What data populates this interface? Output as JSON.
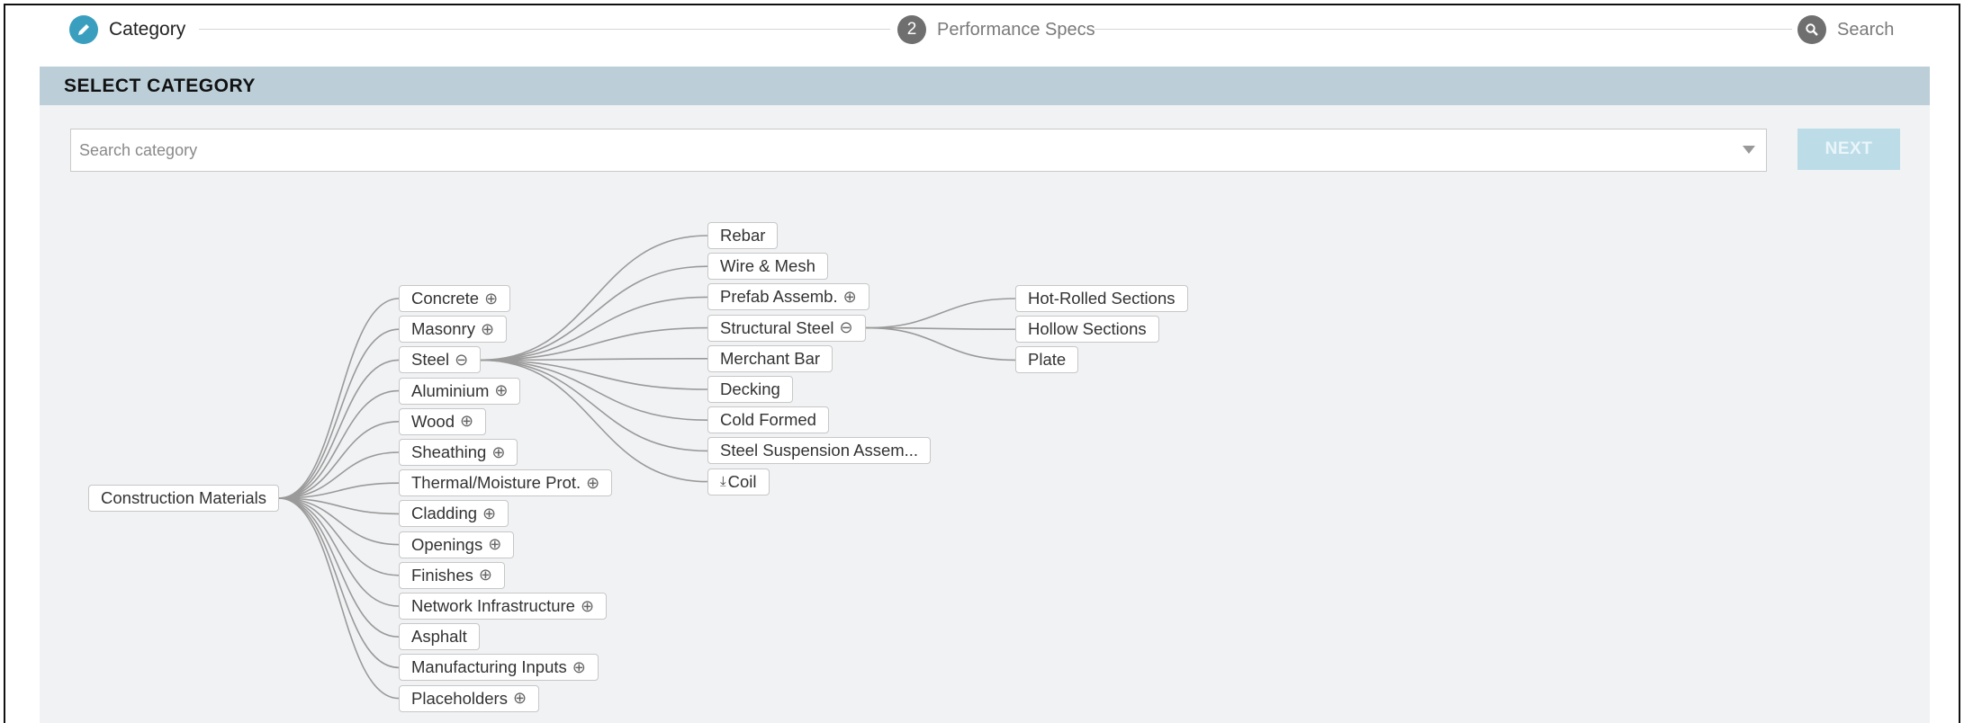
{
  "stepper": {
    "steps": [
      {
        "label": "Category",
        "icon": "pencil-icon"
      },
      {
        "label": "Performance Specs",
        "number": "2"
      },
      {
        "label": "Search",
        "icon": "search-icon"
      }
    ]
  },
  "panel": {
    "title": "SELECT CATEGORY",
    "search_placeholder": "Search category",
    "next_label": "NEXT"
  },
  "colors": {
    "accent": "#3a9fbf",
    "header_bg": "#bccfd9",
    "panel_bg": "#f1f2f4",
    "next_disabled": "#bcdde8"
  },
  "tree": {
    "root": {
      "label": "Construction Materials"
    },
    "level1": [
      {
        "label": "Concrete",
        "toggle": "⊕"
      },
      {
        "label": "Masonry",
        "toggle": "⊕"
      },
      {
        "label": "Steel",
        "toggle": "⊖"
      },
      {
        "label": "Aluminium",
        "toggle": "⊕"
      },
      {
        "label": "Wood",
        "toggle": "⊕"
      },
      {
        "label": "Sheathing",
        "toggle": "⊕"
      },
      {
        "label": "Thermal/Moisture Prot.",
        "toggle": "⊕"
      },
      {
        "label": "Cladding",
        "toggle": "⊕"
      },
      {
        "label": "Openings",
        "toggle": "⊕"
      },
      {
        "label": "Finishes",
        "toggle": "⊕"
      },
      {
        "label": "Network Infrastructure",
        "toggle": "⊕"
      },
      {
        "label": "Asphalt",
        "toggle": ""
      },
      {
        "label": "Manufacturing Inputs",
        "toggle": "⊕"
      },
      {
        "label": "Placeholders",
        "toggle": "⊕"
      }
    ],
    "level2": [
      {
        "label": "Rebar",
        "toggle": ""
      },
      {
        "label": "Wire & Mesh",
        "toggle": ""
      },
      {
        "label": "Prefab Assemb.",
        "toggle": "⊕"
      },
      {
        "label": "Structural Steel",
        "toggle": "⊖"
      },
      {
        "label": "Merchant Bar",
        "toggle": ""
      },
      {
        "label": "Decking",
        "toggle": ""
      },
      {
        "label": "Cold Formed",
        "toggle": ""
      },
      {
        "label": "Steel Suspension Assem...",
        "toggle": ""
      },
      {
        "label": "Coil",
        "toggle": "",
        "icon": "download-icon"
      }
    ],
    "level3": [
      {
        "label": "Hot-Rolled Sections"
      },
      {
        "label": "Hollow Sections"
      },
      {
        "label": "Plate"
      }
    ]
  }
}
